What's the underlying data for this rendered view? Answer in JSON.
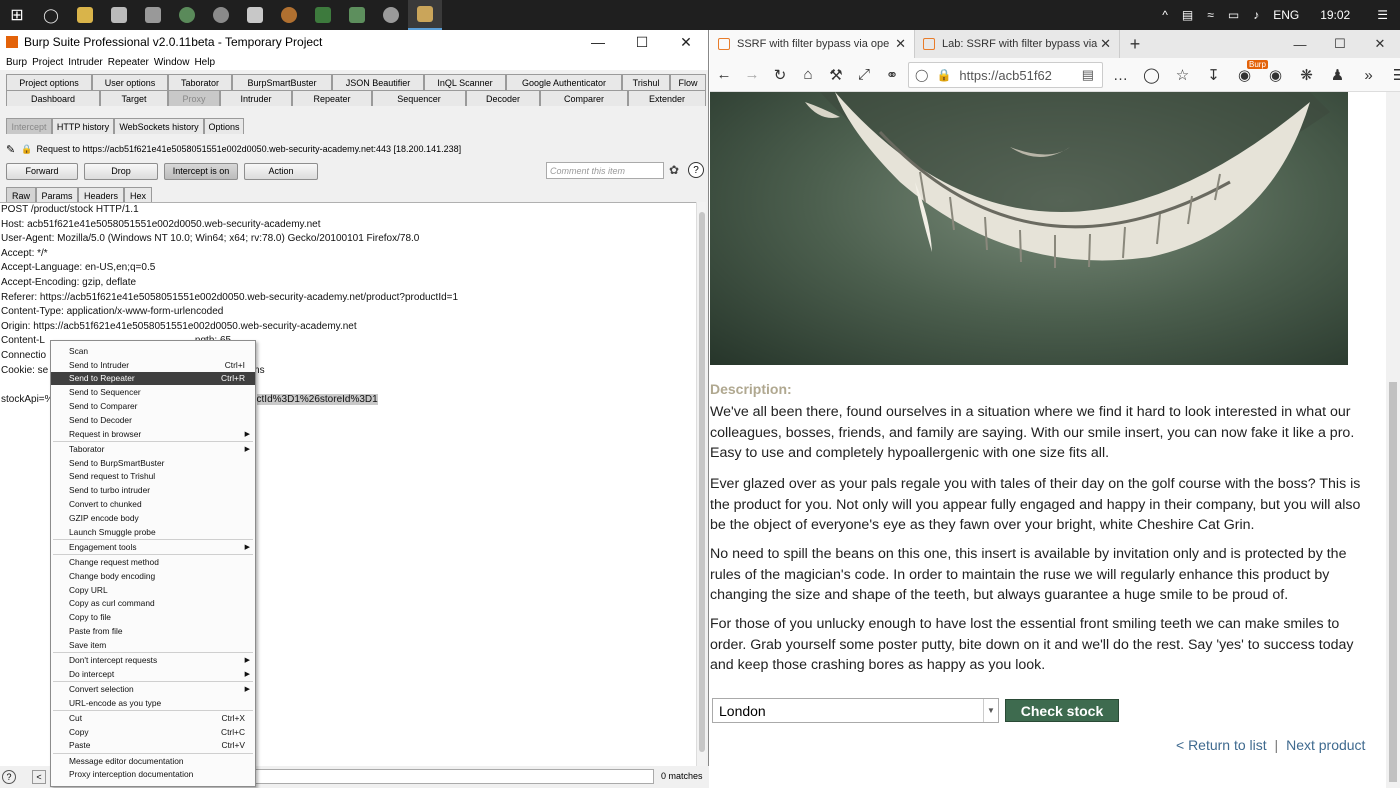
{
  "taskbar": {
    "start_icon": "windows-logo",
    "apps": [
      "search",
      "file-explorer",
      "store",
      "mail",
      "edge",
      "chrome",
      "shield",
      "firefox",
      "green-app",
      "vpn",
      "skype",
      "burp"
    ],
    "tray_up_label": "^",
    "language": "ENG",
    "time": "19:02"
  },
  "burp": {
    "title": "Burp Suite Professional v2.0.11beta - Temporary Project",
    "menu": [
      "Burp",
      "Project",
      "Intruder",
      "Repeater",
      "Window",
      "Help"
    ],
    "tabs_row1": [
      "Project options",
      "User options",
      "Taborator",
      "BurpSmartBuster",
      "JSON Beautifier",
      "InQL Scanner",
      "Google Authenticator",
      "Trishul",
      "Flow"
    ],
    "tabs_row2": [
      "Dashboard",
      "Target",
      "Proxy",
      "Intruder",
      "Repeater",
      "Sequencer",
      "Decoder",
      "Comparer",
      "Extender"
    ],
    "proxy_subtabs": [
      "Intercept",
      "HTTP history",
      "WebSockets history",
      "Options"
    ],
    "request_line": "Request to https://acb51f621e41e5058051551e002d0050.web-security-academy.net:443  [18.200.141.238]",
    "buttons": {
      "forward": "Forward",
      "drop": "Drop",
      "intercept": "Intercept is on",
      "action": "Action"
    },
    "comment_placeholder": "Comment this item",
    "editor_tabs": [
      "Raw",
      "Params",
      "Headers",
      "Hex"
    ],
    "request_lines": [
      "POST /product/stock HTTP/1.1",
      "Host: acb51f621e41e5058051551e002d0050.web-security-academy.net",
      "User-Agent: Mozilla/5.0 (Windows NT 10.0; Win64; x64; rv:78.0) Gecko/20100101 Firefox/78.0",
      "Accept: */*",
      "Accept-Language: en-US,en;q=0.5",
      "Accept-Encoding: gzip, deflate",
      "Referer: https://acb51f621e41e5058051551e002d0050.web-security-academy.net/product?productId=1",
      "Content-Type: application/x-www-form-urlencoded",
      "Origin: https://acb51f621e41e5058051551e002d0050.web-security-academy.net",
      "Content-L",
      "Connectio",
      "Cookie: se",
      "",
      "stockApi=%"
    ],
    "content_length_suffix": "ngth: 65",
    "cookie_suffix": "kms",
    "body_selected_tail": "ctId%3D1%26storeId%3D1",
    "matches": "0 matches",
    "bottom_help": "?",
    "bottom_prev": "<"
  },
  "context_menu": [
    {
      "label": "Scan"
    },
    {
      "label": "Send to Intruder",
      "shortcut": "Ctrl+I"
    },
    {
      "label": "Send to Repeater",
      "shortcut": "Ctrl+R",
      "highlighted": true
    },
    {
      "label": "Send to Sequencer"
    },
    {
      "label": "Send to Comparer"
    },
    {
      "label": "Send to Decoder"
    },
    {
      "label": "Request in browser",
      "submenu": true
    },
    {
      "sep": true
    },
    {
      "label": "Taborator",
      "submenu": true
    },
    {
      "label": "Send to BurpSmartBuster"
    },
    {
      "label": "Send request to Trishul"
    },
    {
      "label": "Send to turbo intruder"
    },
    {
      "label": "Convert to chunked"
    },
    {
      "label": "GZIP encode body"
    },
    {
      "label": "Launch Smuggle probe"
    },
    {
      "sep": true
    },
    {
      "label": "Engagement tools",
      "submenu": true
    },
    {
      "sep": true
    },
    {
      "label": "Change request method"
    },
    {
      "label": "Change body encoding"
    },
    {
      "label": "Copy URL"
    },
    {
      "label": "Copy as curl command"
    },
    {
      "label": "Copy to file"
    },
    {
      "label": "Paste from file"
    },
    {
      "label": "Save item"
    },
    {
      "sep": true
    },
    {
      "label": "Don't intercept requests",
      "submenu": true
    },
    {
      "label": "Do intercept",
      "submenu": true
    },
    {
      "sep": true
    },
    {
      "label": "Convert selection",
      "submenu": true
    },
    {
      "label": "URL-encode as you type"
    },
    {
      "sep": true
    },
    {
      "label": "Cut",
      "shortcut": "Ctrl+X"
    },
    {
      "label": "Copy",
      "shortcut": "Ctrl+C"
    },
    {
      "label": "Paste",
      "shortcut": "Ctrl+V"
    },
    {
      "sep": true
    },
    {
      "label": "Message editor documentation"
    },
    {
      "label": "Proxy interception documentation"
    }
  ],
  "firefox": {
    "tabs": [
      {
        "title": "SSRF with filter bypass via ope"
      },
      {
        "title": "Lab: SSRF with filter bypass via"
      }
    ],
    "url": "https://acb51f62",
    "burp_badge": "Burp",
    "description_title": "Description:",
    "description": [
      "We've all been there, found ourselves in a situation where we find it hard to look interested in what our colleagues, bosses, friends, and family are saying. With our smile insert, you can now fake it like a pro. Easy to use and completely hypoallergenic with one size fits all.",
      "Ever glazed over as your pals regale you with tales of their day on the golf course with the boss? This is the product for you. Not only will you appear fully engaged and happy in their company, but you will also be the object of everyone's eye as they fawn over your bright, white Cheshire Cat Grin.",
      "No need to spill the beans on this one, this insert is available by invitation only and is protected by the rules of the magician's code. In order to maintain the ruse we will regularly enhance this product by changing the size and shape of the teeth, but always guarantee a huge smile to be proud of.",
      "For those of you unlucky enough to have lost the essential front smiling teeth we can make smiles to order. Grab yourself some poster putty, bite down on it and we'll do the rest. Say 'yes' to success today and keep those crashing bores as happy as you look."
    ],
    "store_selected": "London",
    "check_stock": "Check stock",
    "return_link": "< Return to list",
    "link_separator": "|",
    "next_link": "Next product"
  },
  "colors": {
    "check_button": "#3e6b4f",
    "link": "#3f6a8f",
    "menu_highlight": "#3f3f3f",
    "burp_orange": "#e36209"
  }
}
